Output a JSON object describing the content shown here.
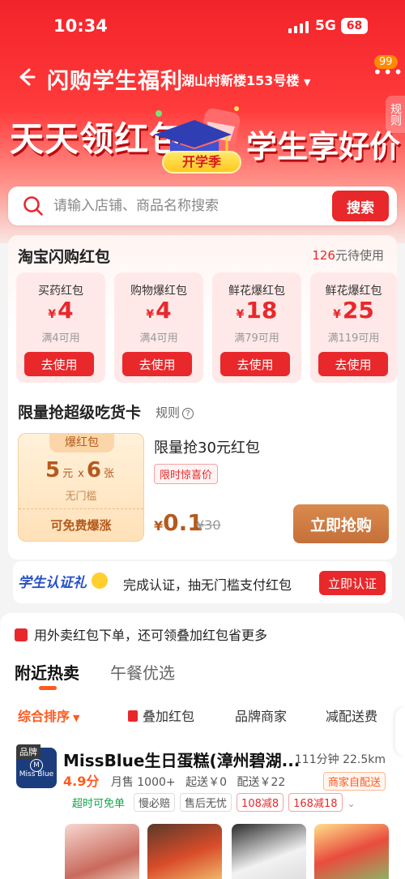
{
  "status_bar": {
    "time": "10:34",
    "network": "5G",
    "battery": "68"
  },
  "header": {
    "title": "闪购学生福利",
    "location": "湖山村新楼153号楼",
    "message_count": "99",
    "rule_label": "规则"
  },
  "banner": {
    "left_text": "天天领红包",
    "right_text": "学生享好价",
    "season_tag": "开学季"
  },
  "search": {
    "placeholder": "请输入店铺、商品名称搜索",
    "button": "搜索"
  },
  "packets": {
    "title": "淘宝闪购红包",
    "pending_amount": "126",
    "pending_suffix": "元待使用",
    "items": [
      {
        "name": "买药红包",
        "currency": "¥",
        "amount": "4",
        "condition": "满4可用",
        "button": "去使用"
      },
      {
        "name": "购物爆红包",
        "currency": "¥",
        "amount": "4",
        "condition": "满4可用",
        "button": "去使用"
      },
      {
        "name": "鲜花爆红包",
        "currency": "¥",
        "amount": "18",
        "condition": "满79可用",
        "button": "去使用"
      },
      {
        "name": "鲜花爆红包",
        "currency": "¥",
        "amount": "25",
        "condition": "满119可用",
        "button": "去使用"
      }
    ]
  },
  "foodie": {
    "title": "限量抢超级吃货卡",
    "rule": "规则",
    "voucher": {
      "tag": "爆红包",
      "value": "5",
      "unit": "元",
      "times": "x",
      "count": "6",
      "count_unit": "张",
      "sub": "无门槛",
      "footer": "可免费爆涨"
    },
    "deal_title": "限量抢30元红包",
    "deal_tag": "限时惊喜价",
    "price_currency": "¥",
    "price": "0.1",
    "original_price": "¥30",
    "button": "立即抢购"
  },
  "student": {
    "logo": "学生认证礼",
    "text": "完成认证，抽无门槛支付红包",
    "button": "立即认证"
  },
  "notice": "用外卖红包下单，还可领叠加红包省更多",
  "tabs": [
    {
      "label": "附近热卖",
      "active": true
    },
    {
      "label": "午餐优选",
      "active": false
    }
  ],
  "filters": {
    "sort": "综合排序",
    "stack": "叠加红包",
    "brand": "品牌商家",
    "fee": "减配送费"
  },
  "store": {
    "brand_tag": "品牌",
    "logo_text": "Miss Blue",
    "logo_mono": "M",
    "name": "MissBlue生日蛋糕(漳州碧湖...",
    "time": "111分钟",
    "distance": "22.5km",
    "rating": "4.9分",
    "monthly": "月售 1000+",
    "min_order": "起送￥0",
    "delivery": "配送￥22",
    "self_delivery": "商家自配送",
    "tags": [
      "超时可免单",
      "慢必赔",
      "售后无忧",
      "108减8",
      "168减18"
    ]
  },
  "colors": {
    "brand_red": "#e8282b",
    "accent_orange": "#ff5a1f",
    "gold": "#b45a1d"
  }
}
